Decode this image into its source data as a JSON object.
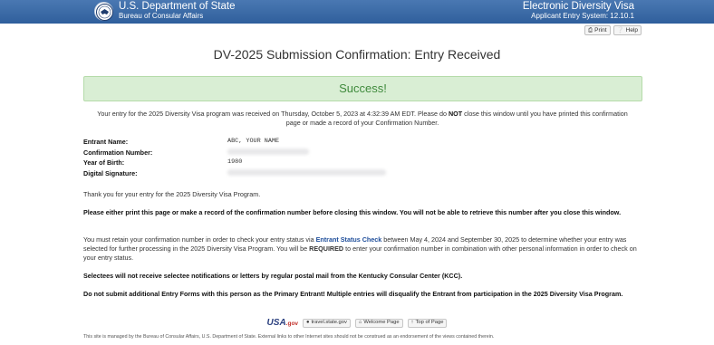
{
  "header": {
    "agency_title": "U.S. Department of State",
    "agency_subtitle": "Bureau of Consular Affairs",
    "app_title": "Electronic Diversity Visa",
    "app_system": "Applicant Entry System: 12.10.1",
    "seal_icon": "department-seal-icon",
    "bg_color": "#3a6aa8"
  },
  "toolbar": {
    "print_label": "Print",
    "help_label": "Help",
    "print_icon": "printer-icon",
    "help_icon": "help-icon"
  },
  "page_title": "DV-2025 Submission Confirmation: Entry Received",
  "success": {
    "label": "Success!",
    "bg_color": "#d9eed4",
    "text_color": "#3f8a3c"
  },
  "intro": {
    "part1": "Your entry for the 2025 Diversity Visa program was received on Thursday, October 5, 2023 at 4:32:39 AM EDT. Please do ",
    "not": "NOT",
    "part2": " close this window until you have printed this confirmation page or made a record of your Confirmation Number."
  },
  "entry": {
    "name_label": "Entrant Name:",
    "name_value": "ABC, YOUR NAME",
    "confirmation_label": "Confirmation Number:",
    "year_label": "Year of Birth:",
    "year_value": "1980",
    "signature_label": "Digital Signature:"
  },
  "paragraphs": {
    "thank_you": "Thank you for your entry for the 2025 Diversity Visa Program.",
    "print_warning": "Please either print this page or make a record of the confirmation number before closing this window. You will not be able to retrieve this number after you close this window.",
    "retain_part1": "You must retain your confirmation number in order to check your entry status via ",
    "retain_link": "Entrant Status Check",
    "retain_part2": " between May 4, 2024 and September 30, 2025 to determine whether your entry was selected for further processing in the 2025 Diversity Visa Program. You will be ",
    "retain_required": "REQUIRED",
    "retain_part3": " to enter your confirmation number in combination with other personal information in order to check on your entry status.",
    "selectees": "Selectees will not receive selectee notifications or letters by regular postal mail from the Kentucky Consular Center (KCC).",
    "no_additional": "Do not submit additional Entry Forms with this person as the Primary Entrant! Multiple entries will disqualify the Entrant from participation in the 2025 Diversity Visa Program."
  },
  "footer": {
    "usa_logo": "USA",
    "usa_suffix": ".gov",
    "travel_label": "travel.state.gov",
    "welcome_label": "Welcome Page",
    "top_label": "Top of Page",
    "travel_icon": "globe-icon",
    "welcome_icon": "home-icon",
    "top_icon": "arrow-up-icon",
    "disclaimer": "This site is managed by the Bureau of Consular Affairs, U.S. Department of State. External links to other Internet sites should not be construed as an endorsement of the views contained therein."
  }
}
